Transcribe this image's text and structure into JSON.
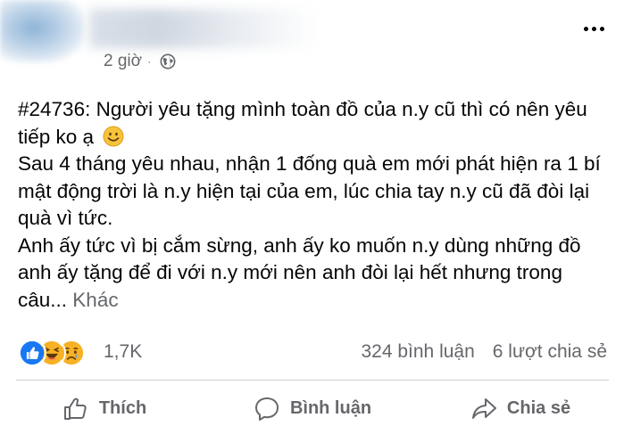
{
  "post": {
    "time": "2 giờ",
    "separator": "·",
    "privacy_icon": "globe-icon",
    "text_line1": "#24736: Người yêu tặng mình toàn đồ của n.y cũ thì có nên yêu tiếp ko ạ",
    "text_line2": "Sau 4 tháng yêu nhau, nhận 1 đống quà em mới phát hiện ra 1 bí mật động trời là n.y hiện tại của em, lúc chia tay n.y cũ đã đòi lại quà vì tức.",
    "text_line3": "Anh ấy tức vì bị cắm sừng, anh ấy ko muốn n.y dùng những đồ anh ấy tặng để đi với n.y mới nên anh đòi lại hết nhưng trong câu...",
    "see_more": "Khác"
  },
  "stats": {
    "reactions": [
      "like-icon",
      "haha-icon",
      "sad-icon"
    ],
    "reaction_count": "1,7K",
    "comments": "324 bình luận",
    "shares": "6 lượt chia sẻ"
  },
  "actions": {
    "like": "Thích",
    "comment": "Bình luận",
    "share": "Chia sẻ"
  },
  "colors": {
    "text": "#050505",
    "secondary": "#65676b",
    "like_blue": "#1877f2",
    "emoji_yellow": "#f7b125"
  }
}
